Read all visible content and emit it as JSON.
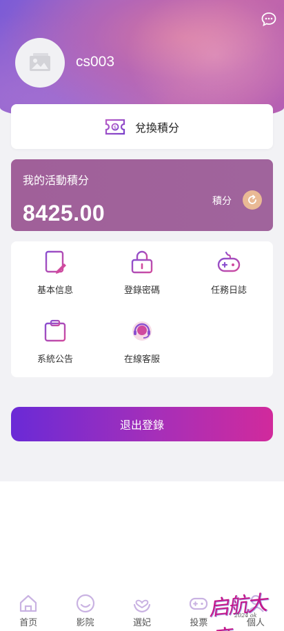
{
  "profile": {
    "username": "cs003",
    "avatar_icon": "image-placeholder-icon",
    "chat_icon": "chat-bubble-icon"
  },
  "exchange": {
    "label": "兌換積分",
    "icon": "ticket-icon"
  },
  "points": {
    "title": "我的活動積分",
    "value": "8425.00",
    "unit": "積分",
    "refresh_icon": "refresh-icon"
  },
  "menu": {
    "items": [
      {
        "label": "基本信息",
        "icon": "edit-document-icon"
      },
      {
        "label": "登錄密碼",
        "icon": "lock-icon"
      },
      {
        "label": "任務日誌",
        "icon": "gamepad-icon"
      },
      {
        "label": "系統公告",
        "icon": "notice-board-icon"
      },
      {
        "label": "在線客服",
        "icon": "headset-support-icon"
      }
    ]
  },
  "logout": {
    "label": "退出登錄"
  },
  "tabbar": {
    "items": [
      {
        "label": "首页",
        "icon": "home-icon"
      },
      {
        "label": "影院",
        "icon": "smile-icon"
      },
      {
        "label": "選妃",
        "icon": "heart-hands-icon"
      },
      {
        "label": "投票",
        "icon": "gamepad-icon"
      },
      {
        "label": "個人",
        "icon": "person-icon"
      }
    ]
  },
  "watermark": {
    "text": "启航大帝",
    "sub": "2024 ok"
  },
  "colors": {
    "accent_purple": "#6a2ad6",
    "accent_pink": "#d12a9c",
    "points_card": "#a06099",
    "refresh_button": "#e9b995",
    "page_bg": "#f2f2f5"
  }
}
